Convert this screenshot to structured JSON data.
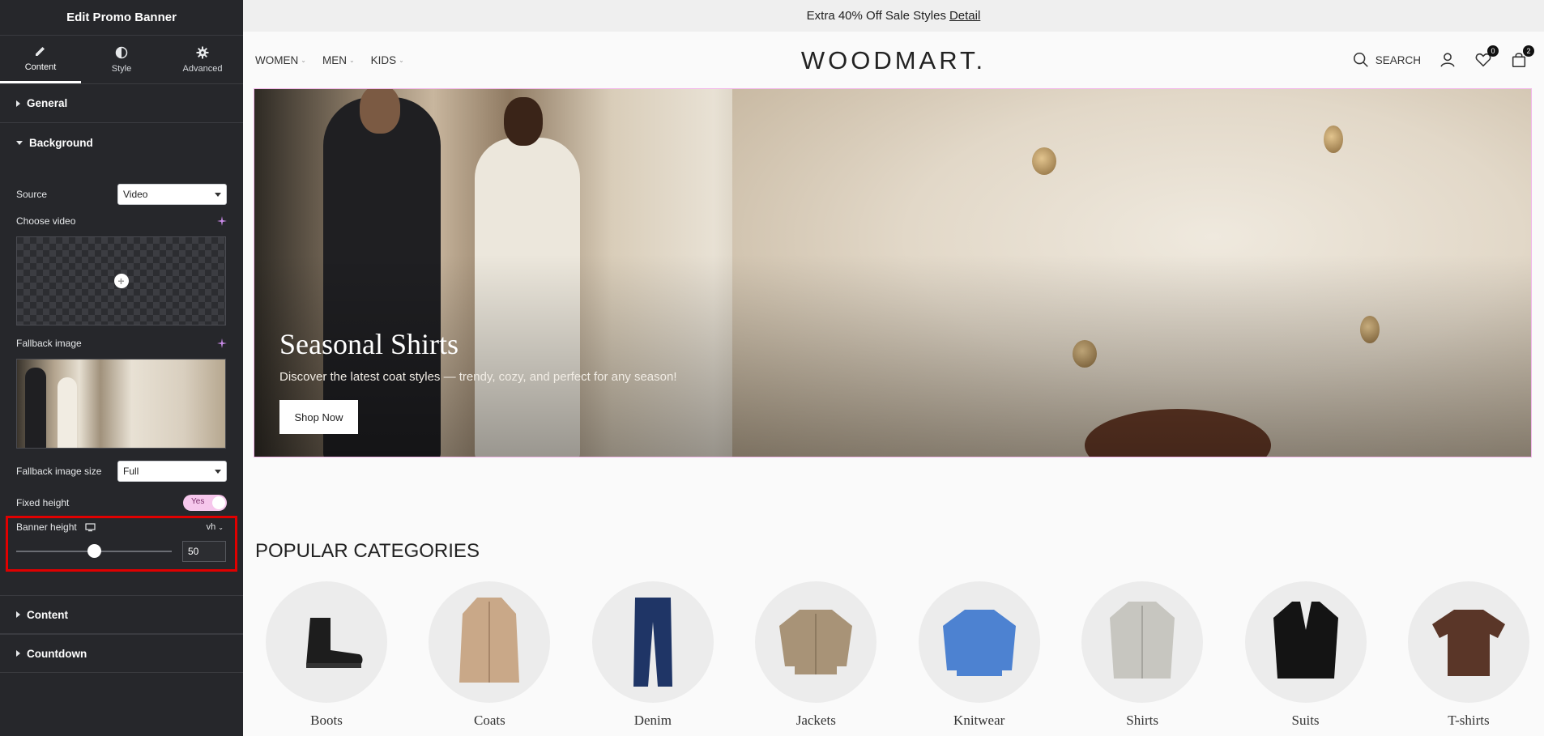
{
  "editor": {
    "title": "Edit Promo Banner",
    "tabs": [
      {
        "label": "Content",
        "icon": "pencil-icon",
        "active": true
      },
      {
        "label": "Style",
        "icon": "half-circle-icon",
        "active": false
      },
      {
        "label": "Advanced",
        "icon": "gear-icon",
        "active": false
      }
    ],
    "sections": {
      "general": "General",
      "background": "Background",
      "content": "Content",
      "countdown": "Countdown"
    },
    "source": {
      "label": "Source",
      "value": "Video"
    },
    "choose_video": {
      "label": "Choose video"
    },
    "fallback_image": {
      "label": "Fallback image"
    },
    "fallback_size": {
      "label": "Fallback image size",
      "value": "Full"
    },
    "fixed_height": {
      "label": "Fixed height",
      "value": "Yes"
    },
    "banner_height": {
      "label": "Banner height",
      "unit": "vh",
      "value": "50"
    }
  },
  "site": {
    "topbar": {
      "text": "Extra 40% Off Sale Styles",
      "link": "Detail"
    },
    "nav": [
      "WOMEN",
      "MEN",
      "KIDS"
    ],
    "logo": "WOODMART.",
    "search_label": "SEARCH",
    "wishlist_count": "0",
    "cart_count": "2",
    "hero": {
      "title": "Seasonal Shirts",
      "subtitle": "Discover the latest coat styles — trendy, cozy, and perfect for any season!",
      "button": "Shop Now"
    },
    "categories_title": "POPULAR CATEGORIES",
    "categories": [
      "Boots",
      "Coats",
      "Denim",
      "Jackets",
      "Knitwear",
      "Shirts",
      "Suits",
      "T-shirts"
    ]
  },
  "colors": {
    "panel_bg": "#26272b",
    "highlight": "#e00000",
    "toggle_on": "#f6c7ec",
    "hero_border": "#f2b6ea"
  }
}
